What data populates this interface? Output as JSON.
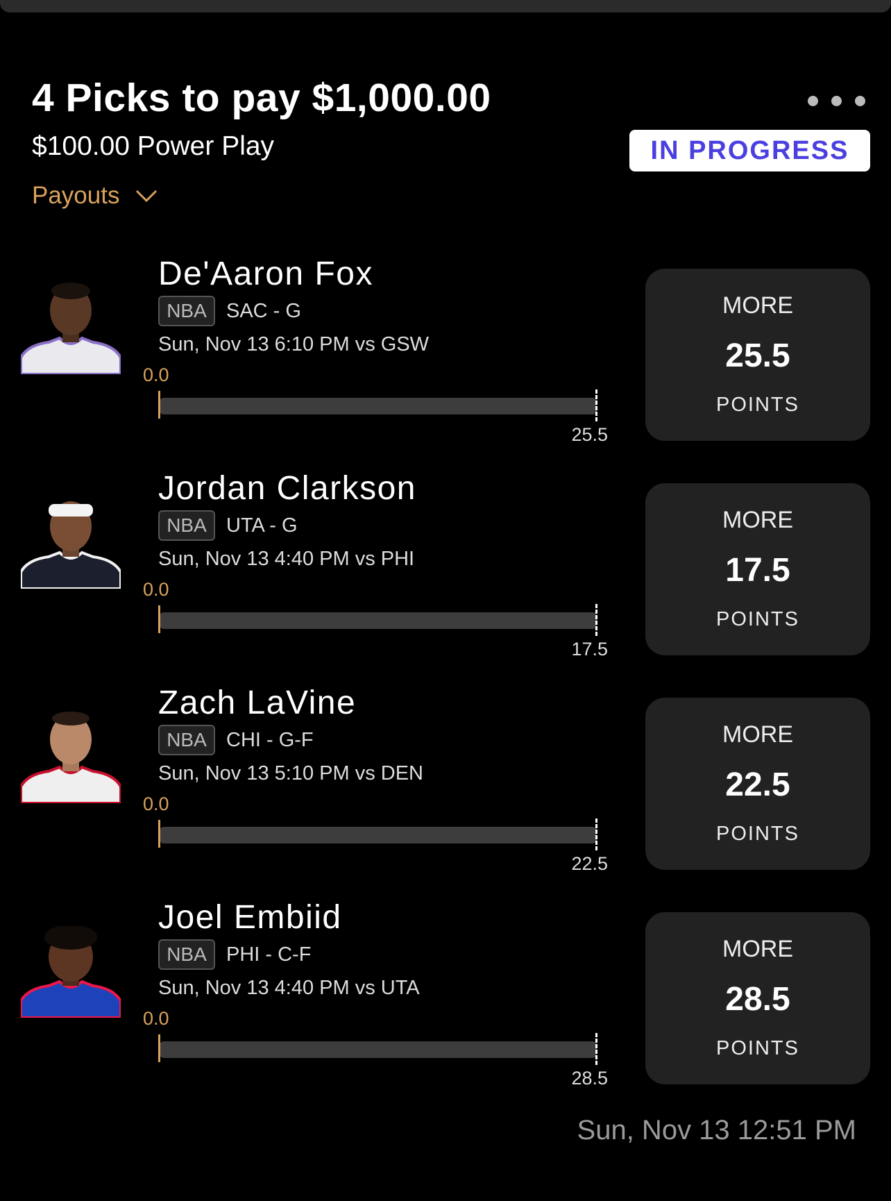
{
  "header": {
    "title": "4 Picks to pay $1,000.00",
    "subtitle": "$100.00 Power Play",
    "payouts_label": "Payouts",
    "status": "IN PROGRESS"
  },
  "picks": [
    {
      "name": "De'Aaron Fox",
      "league": "NBA",
      "team_pos": "SAC - G",
      "game": "Sun, Nov 13 6:10 PM  vs GSW",
      "current": "0.0",
      "target": "25.5",
      "direction": "MORE",
      "line": "25.5",
      "stat": "POINTS",
      "jersey_color": "#e9e9ee",
      "trim_color": "#8a6fc7"
    },
    {
      "name": "Jordan Clarkson",
      "league": "NBA",
      "team_pos": "UTA - G",
      "game": "Sun, Nov 13 4:40 PM  vs PHI",
      "current": "0.0",
      "target": "17.5",
      "direction": "MORE",
      "line": "17.5",
      "stat": "POINTS",
      "jersey_color": "#1b1f2e",
      "trim_color": "#f2f2f2"
    },
    {
      "name": "Zach LaVine",
      "league": "NBA",
      "team_pos": "CHI - G-F",
      "game": "Sun, Nov 13 5:10 PM  vs DEN",
      "current": "0.0",
      "target": "22.5",
      "direction": "MORE",
      "line": "22.5",
      "stat": "POINTS",
      "jersey_color": "#efefef",
      "trim_color": "#c8102e"
    },
    {
      "name": "Joel Embiid",
      "league": "NBA",
      "team_pos": "PHI - C-F",
      "game": "Sun, Nov 13 4:40 PM  vs UTA",
      "current": "0.0",
      "target": "28.5",
      "direction": "MORE",
      "line": "28.5",
      "stat": "POINTS",
      "jersey_color": "#1d42ba",
      "trim_color": "#ed174c"
    }
  ],
  "footer": {
    "timestamp": "Sun, Nov 13 12:51 PM"
  },
  "colors": {
    "accent": "#d9a25c",
    "status_text": "#4b3fe0",
    "card_bg": "#222222"
  }
}
